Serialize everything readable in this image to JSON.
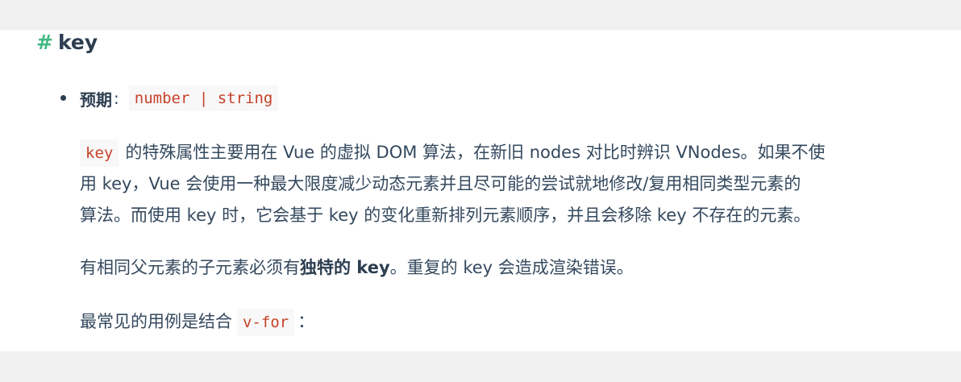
{
  "heading": {
    "hash": "#",
    "title": "key"
  },
  "expect": {
    "label": "预期",
    "colon": ":",
    "type_code": "number | string"
  },
  "para1": {
    "code": "key",
    "line1_text": "的特殊属性主要用在 Vue 的虚拟 DOM 算法，在新旧 nodes 对比时辨识 VNodes。如果不使",
    "line2": "用 key，Vue 会使用一种最大限度减少动态元素并且尽可能的尝试就地修改/复用相同类型元素的",
    "line3": "算法。而使用 key 时，它会基于 key 的变化重新排列元素顺序，并且会移除 key 不存在的元素。"
  },
  "para2": {
    "before": "有相同父元素的子元素必须有",
    "bold": "独特的 key",
    "after": "。重复的 key 会造成渲染错误。"
  },
  "para3": {
    "before": "最常见的用例是结合",
    "code": "v-for",
    "after": "："
  },
  "colors": {
    "hash_accent": "#42b983",
    "code_text": "#c7412a",
    "code_background": "#f8f8f8",
    "body_text": "#34495e",
    "heading_text": "#2c3e50"
  }
}
